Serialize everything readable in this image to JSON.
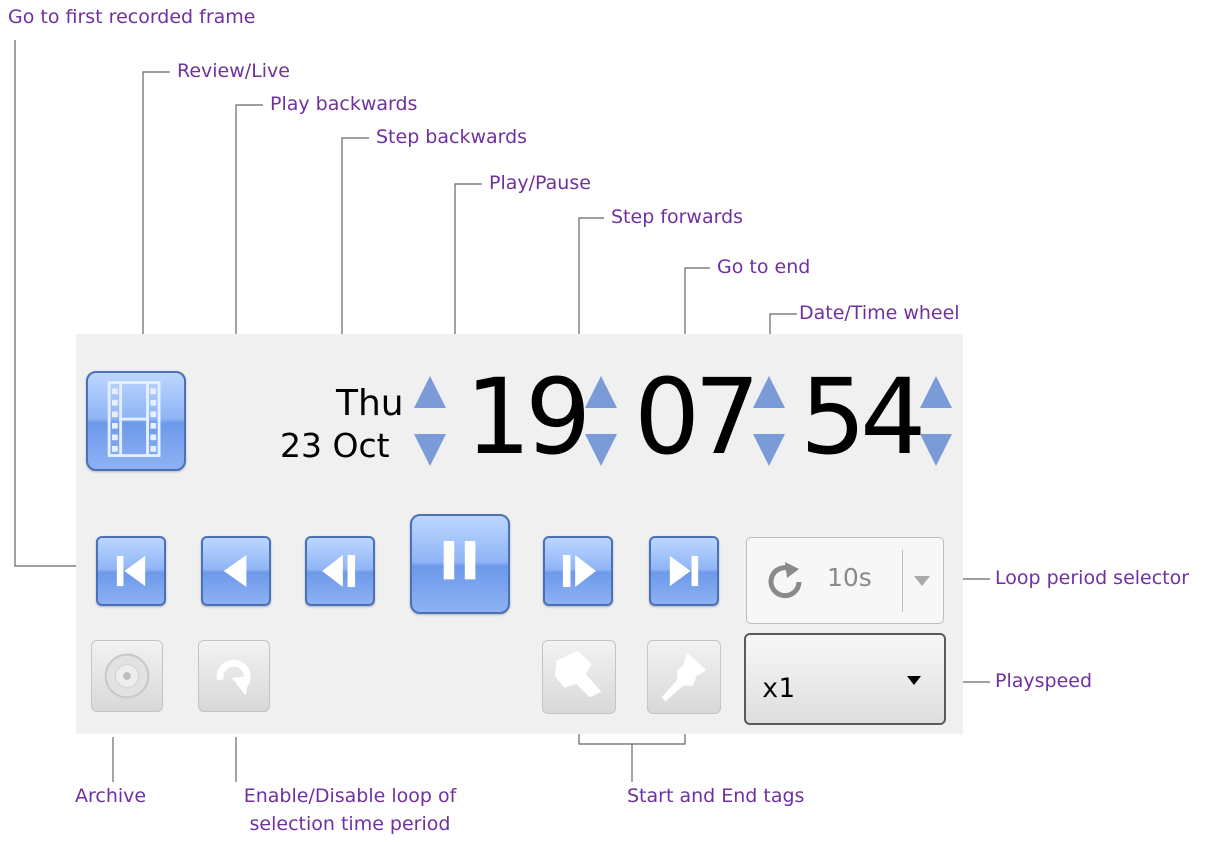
{
  "annotations": {
    "first_frame": "Go to first recorded frame",
    "review_live": "Review/Live",
    "play_backwards": "Play backwards",
    "step_backwards": "Step backwards",
    "play_pause": "Play/Pause",
    "step_forwards": "Step forwards",
    "go_to_end": "Go to end",
    "date_time_wheel": "Date/Time wheel",
    "loop_period_selector": "Loop period selector",
    "playspeed": "Playspeed",
    "archive": "Archive",
    "loop_toggle_line1": "Enable/Disable loop of",
    "loop_toggle_line2": "selection time period",
    "start_end_tags": "Start and End tags"
  },
  "player": {
    "day_name": "Thu",
    "day_date": "23 Oct",
    "hours": "19",
    "minutes": "07",
    "seconds": "54",
    "loop_period": "10s",
    "playspeed": "x1"
  },
  "colors": {
    "annotation": "#7030a0",
    "button_blue": "#8fb4f5",
    "spinner_arrow": "#7b9ad8",
    "panel_bg": "#f0f0f0"
  },
  "icons": [
    "film-icon",
    "skip-to-start-icon",
    "play-backwards-icon",
    "step-backwards-icon",
    "pause-icon",
    "step-forwards-icon",
    "skip-to-end-icon",
    "loop-icon",
    "dropdown-arrow-icon",
    "disc-icon",
    "loop-toggle-icon",
    "start-tag-icon",
    "end-tag-icon"
  ]
}
